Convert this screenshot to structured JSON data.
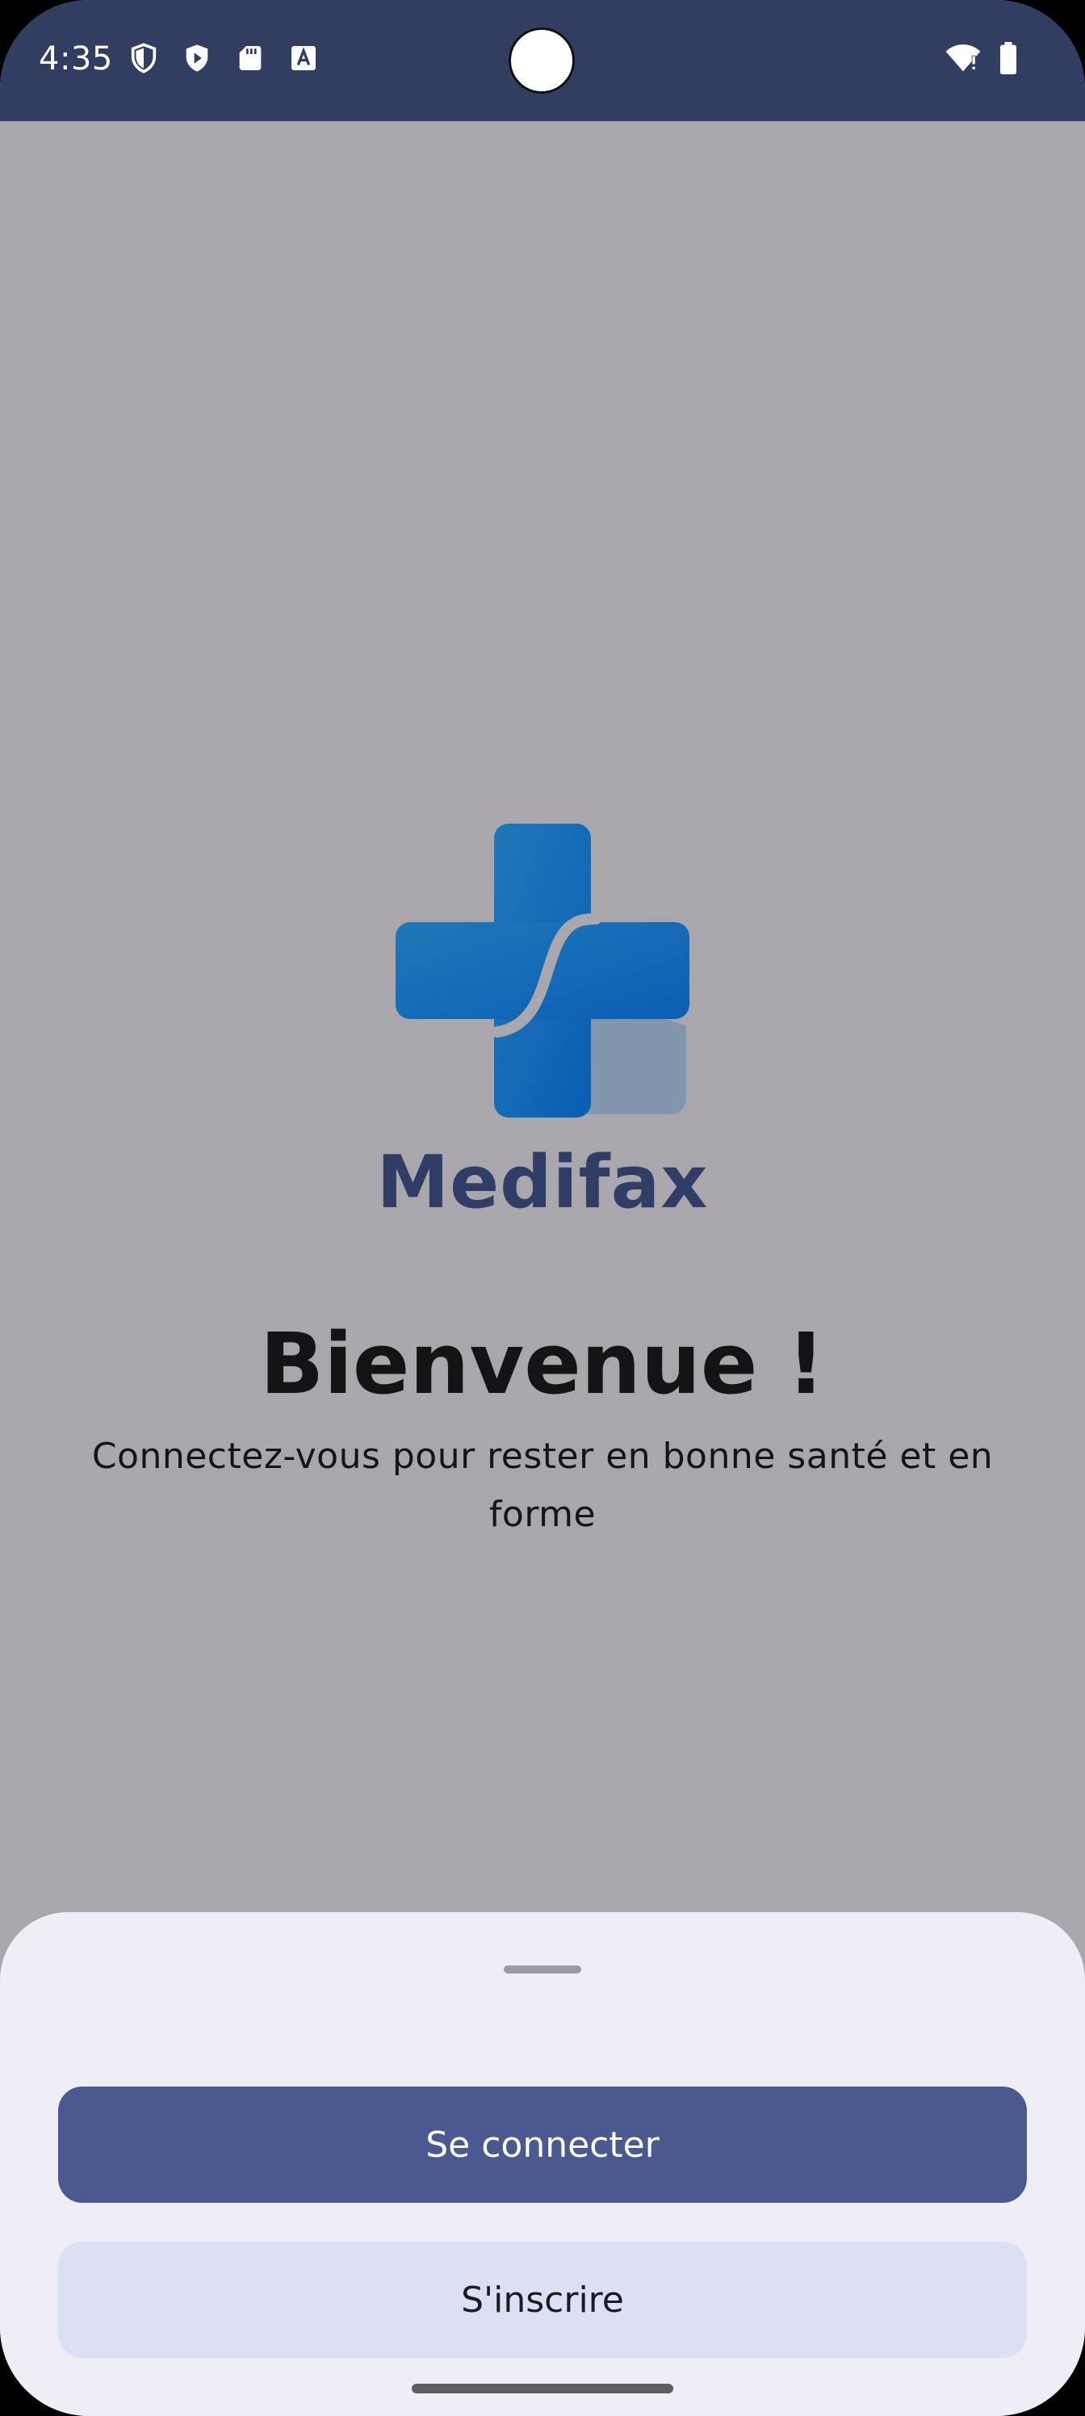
{
  "status_bar": {
    "time": "4:35",
    "left_icons": [
      "shield-icon",
      "play-protect-icon",
      "sd-card-icon",
      "text-a-icon"
    ],
    "right_icons": [
      "wifi-alert-icon",
      "battery-icon"
    ]
  },
  "brand": {
    "name": "Medifax",
    "logo": "medical-cross-logo",
    "primary_color": "#0a62b8",
    "text_color": "#303e67"
  },
  "welcome": {
    "title": "Bienvenue !",
    "subtitle": "Connectez-vous pour rester en bonne santé et en forme"
  },
  "bottom_sheet": {
    "login_label": "Se connecter",
    "signup_label": "S'inscrire"
  },
  "colors": {
    "status_bar": "#313d61",
    "scrim": "#a9a7ac",
    "sheet": "#efeef6",
    "primary_button": "#4a5990",
    "secondary_button": "#dce0f5"
  }
}
